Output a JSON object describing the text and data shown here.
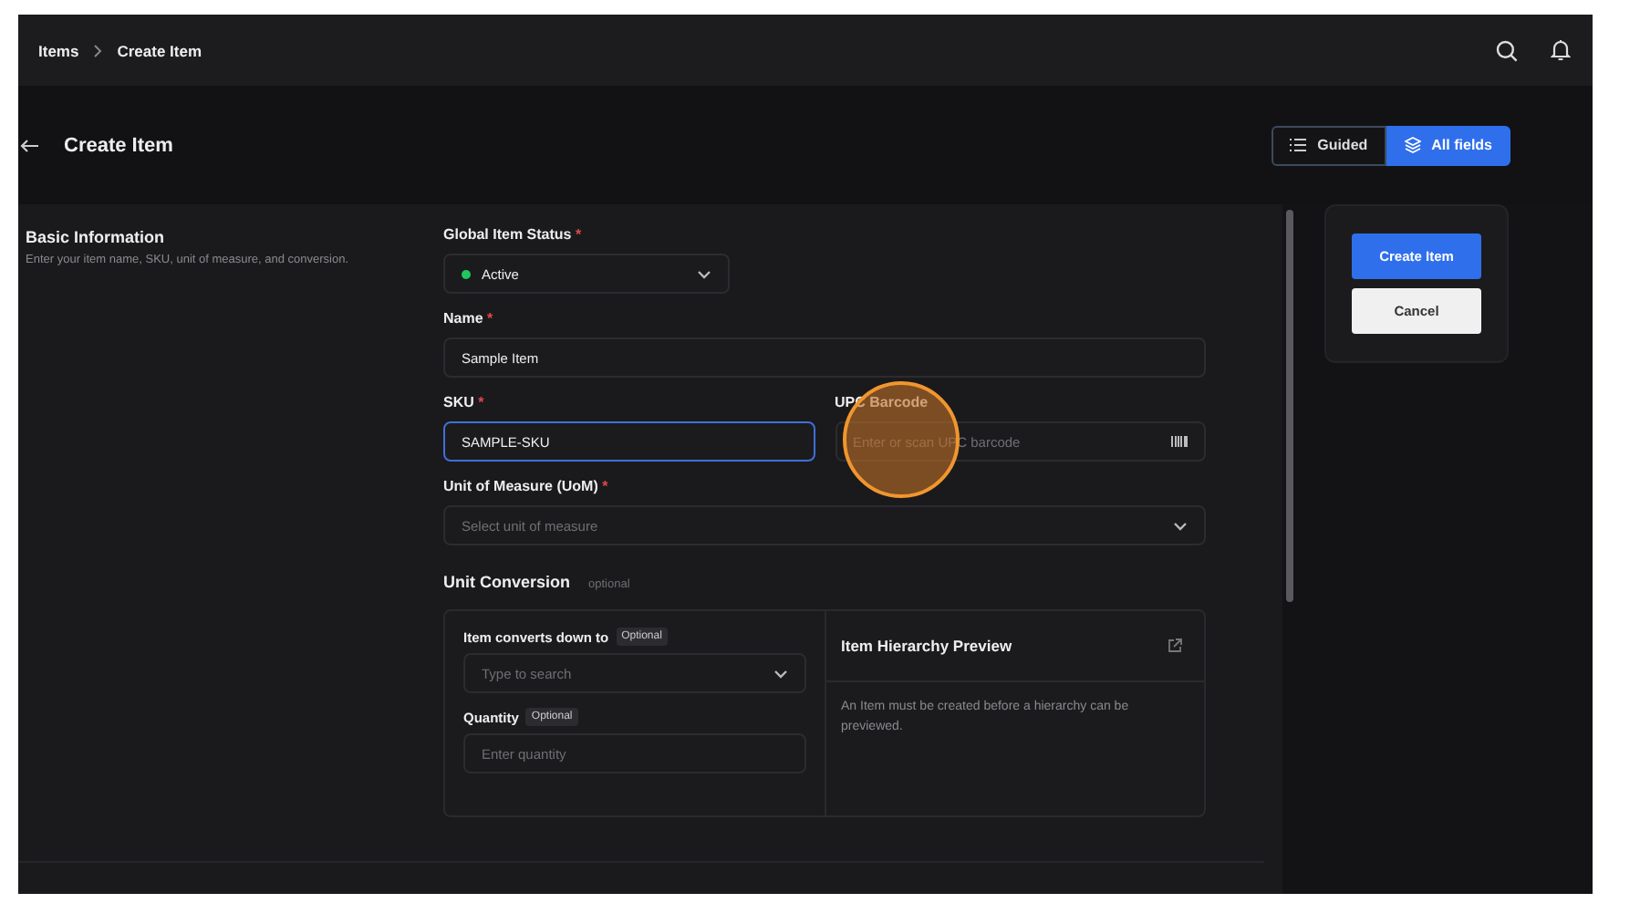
{
  "breadcrumb": [
    {
      "label": "Items"
    },
    {
      "label": "Create Item"
    }
  ],
  "page_title": "Create Item",
  "view_toggle": [
    {
      "label": "Guided",
      "selected": false
    },
    {
      "label": "All fields",
      "selected": true
    }
  ],
  "section": {
    "title": "Basic Information",
    "description": "Enter your item name, SKU, unit of measure, and conversion."
  },
  "status_field": {
    "label": "Global Item Status",
    "required_mark": "*",
    "value": "Active",
    "color": "#22c55e"
  },
  "name_field": {
    "label": "Name",
    "required_mark": "*",
    "value": "Sample Item",
    "focused": false
  },
  "sku_field": {
    "label": "SKU",
    "required_mark": "*",
    "value": "SAMPLE-SKU",
    "focused": true
  },
  "upc_field": {
    "label": "UPC Barcode",
    "placeholder": "Enter or scan UPC barcode",
    "focused": false
  },
  "uom_field": {
    "label": "Unit of Measure (UoM)",
    "required_mark": "*",
    "placeholder": "Select unit of measure"
  },
  "unit_conversion": {
    "title": "Unit Conversion",
    "tag": "optional",
    "converts_field": {
      "label": "Item converts down to",
      "badge": "Optional",
      "placeholder": "Type to search"
    },
    "quantity_field": {
      "label": "Quantity",
      "badge": "Optional",
      "placeholder": "Enter quantity",
      "focused": false
    },
    "preview": {
      "title": "Item Hierarchy Preview",
      "message": "An Item must be created before a hierarchy can be previewed."
    }
  },
  "actions": [
    {
      "label": "Create Item",
      "kind": "primary"
    },
    {
      "label": "Cancel",
      "kind": "secondary"
    }
  ]
}
